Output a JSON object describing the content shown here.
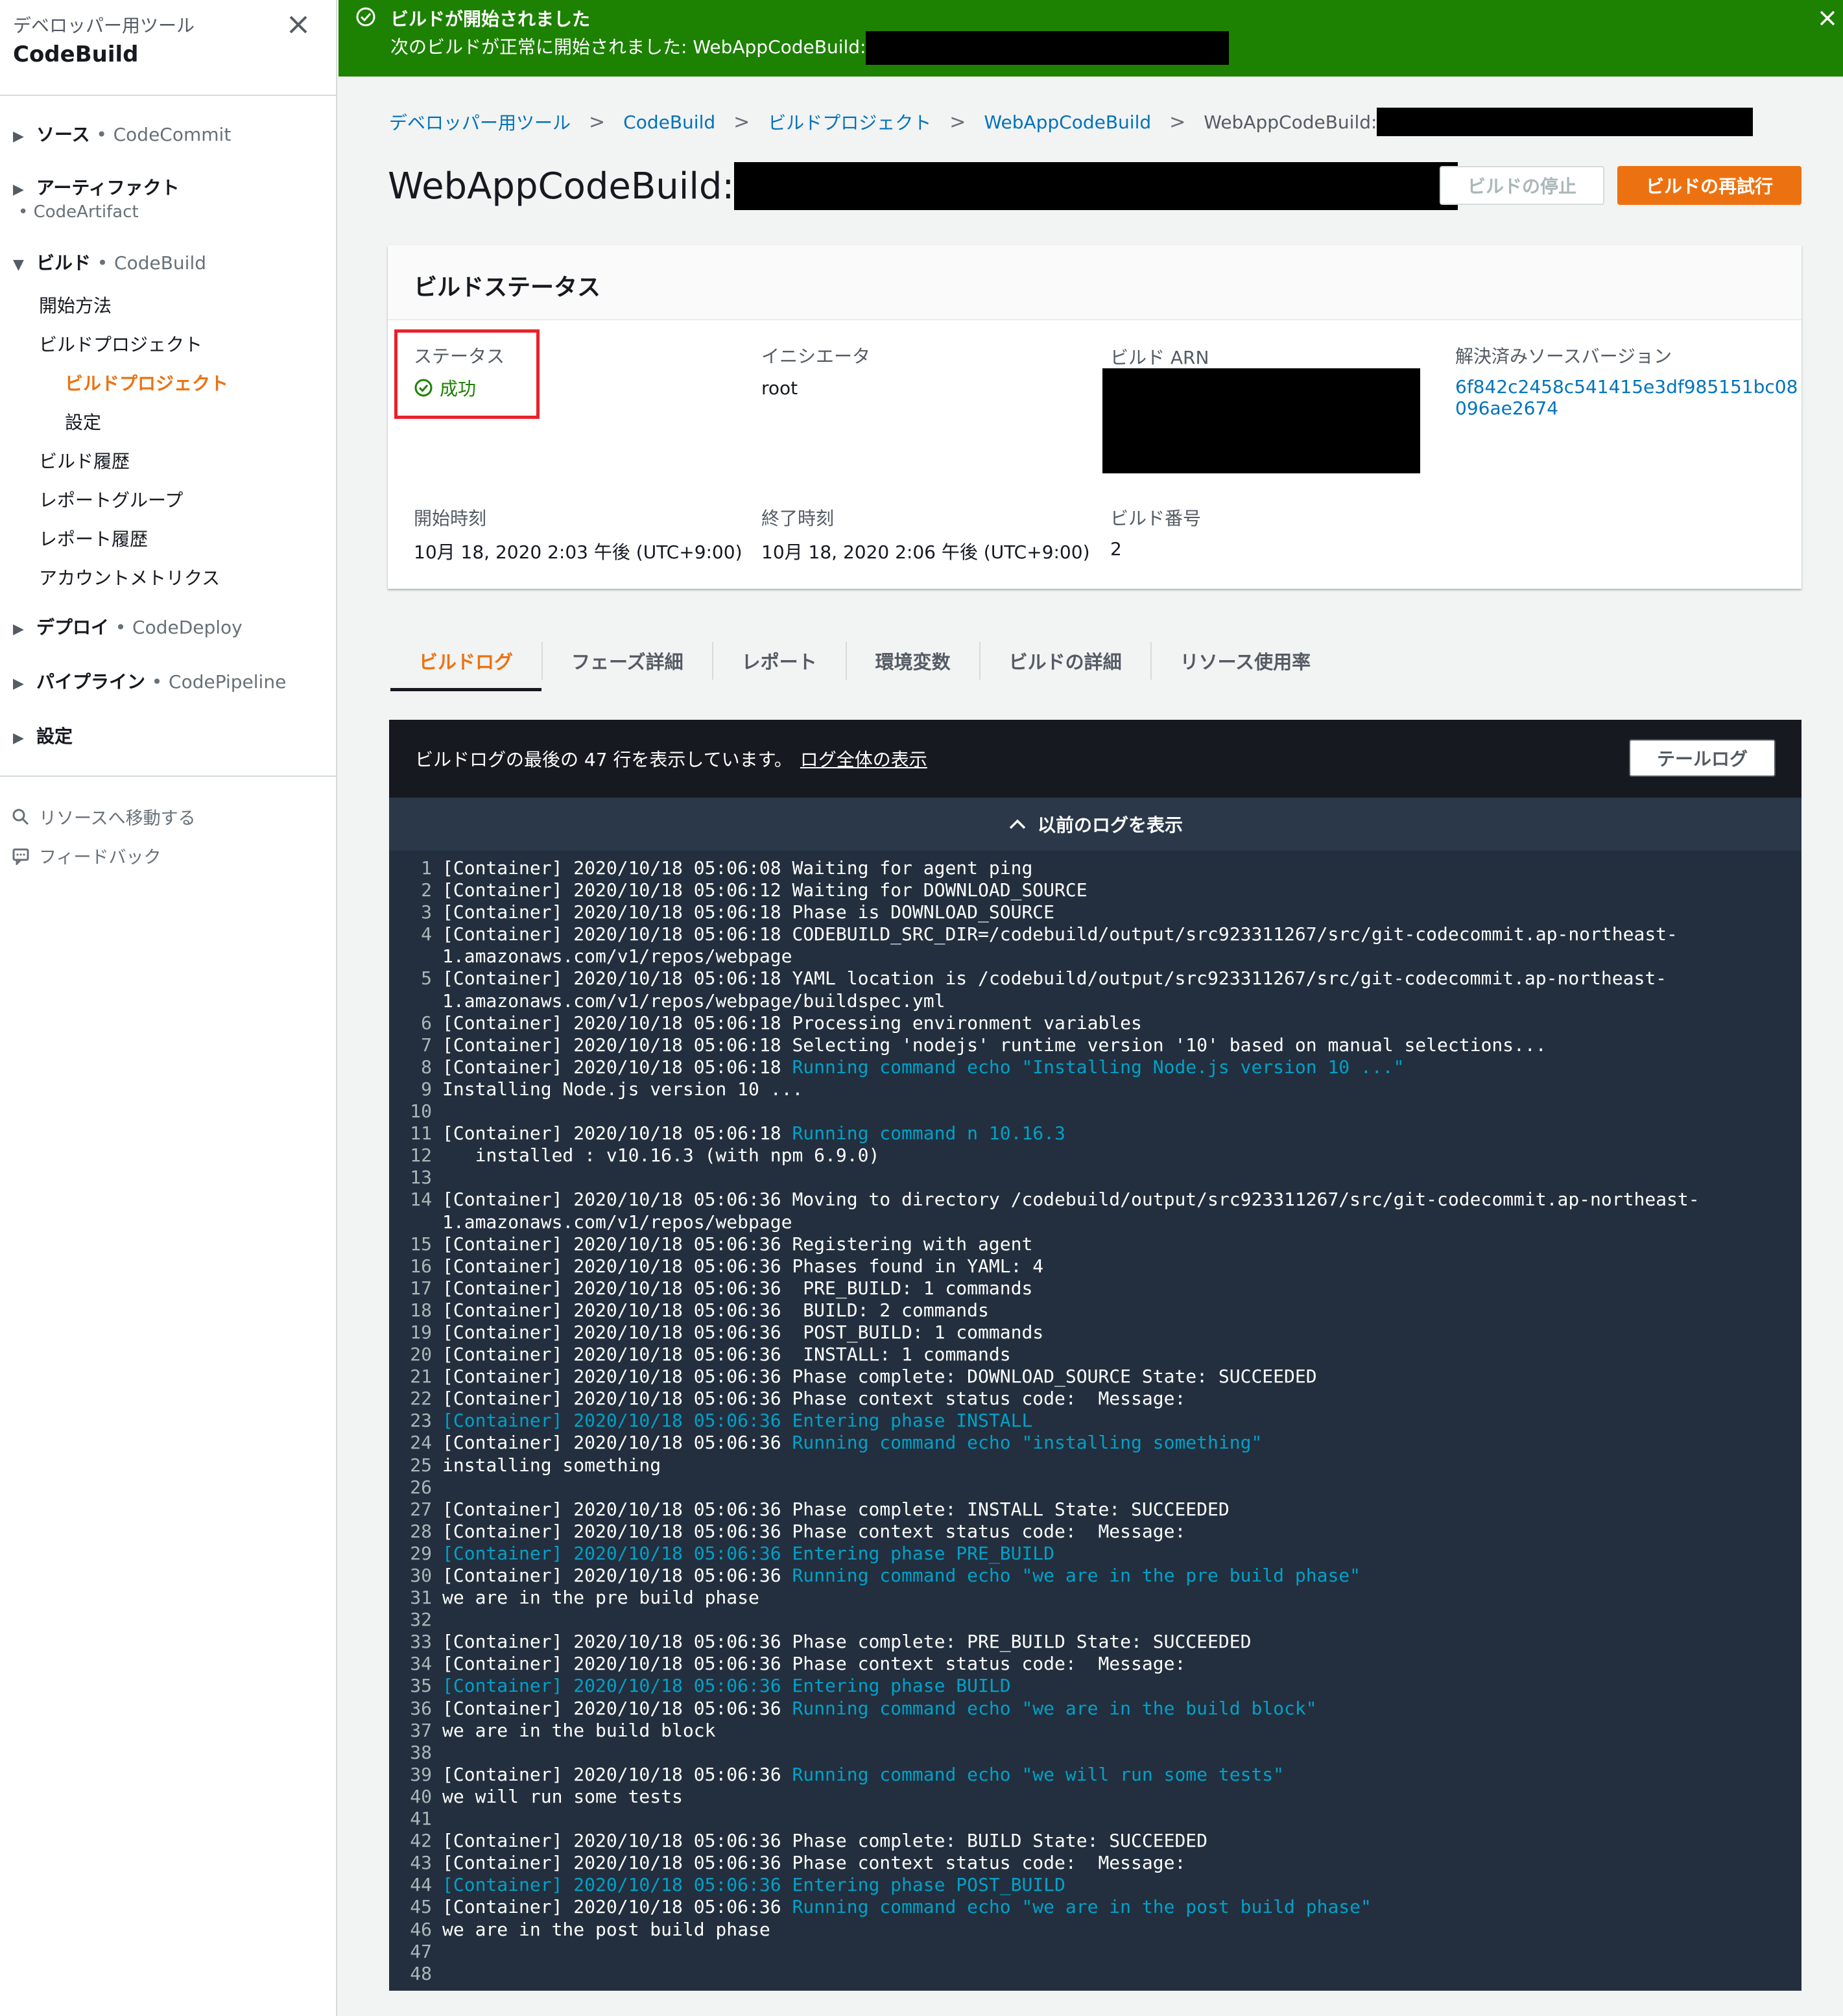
{
  "sidebar": {
    "service": "デベロッパー用ツール",
    "title": "CodeBuild",
    "sections": [
      {
        "label": "ソース",
        "service": "CodeCommit"
      },
      {
        "label": "アーティファクト",
        "service": "CodeArtifact"
      },
      {
        "label": "ビルド",
        "service": "CodeBuild"
      },
      {
        "label": "デプロイ",
        "service": "CodeDeploy"
      },
      {
        "label": "パイプライン",
        "service": "CodePipeline"
      },
      {
        "label": "設定",
        "service": ""
      }
    ],
    "build_items": [
      "開始方法",
      "ビルドプロジェクト",
      "ビルドプロジェクト",
      "設定",
      "ビルド履歴",
      "レポートグループ",
      "レポート履歴",
      "アカウントメトリクス"
    ],
    "utility": [
      "リソースへ移動する",
      "フィードバック"
    ]
  },
  "flash": {
    "title": "ビルドが開始されました",
    "message": "次のビルドが正常に開始されました: WebAppCodeBuild:"
  },
  "breadcrumb": [
    "デベロッパー用ツール",
    "CodeBuild",
    "ビルドプロジェクト",
    "WebAppCodeBuild",
    "WebAppCodeBuild:"
  ],
  "page": {
    "title": "WebAppCodeBuild:",
    "stop_button": "ビルドの停止",
    "retry_button": "ビルドの再試行"
  },
  "status_card": {
    "title": "ビルドステータス",
    "status_label": "ステータス",
    "status_value": "成功",
    "initiator_label": "イニシエータ",
    "initiator_value": "root",
    "arn_label": "ビルド ARN",
    "source_version_label": "解決済みソースバージョン",
    "source_version_line1": "6f842c2458c541415e3df985151bc08",
    "source_version_line2": "096ae2674",
    "start_label": "開始時刻",
    "start_value": "10月 18, 2020 2:03 午後 (UTC+9:00)",
    "end_label": "終了時刻",
    "end_value": "10月 18, 2020 2:06 午後 (UTC+9:00)",
    "build_number_label": "ビルド番号",
    "build_number_value": "2"
  },
  "tabs": [
    "ビルドログ",
    "フェーズ詳細",
    "レポート",
    "環境変数",
    "ビルドの詳細",
    "リソース使用率"
  ],
  "log": {
    "info": "ビルドログの最後の 47 行を表示しています。",
    "full_link": "ログ全体の表示",
    "tail_button": "テールログ",
    "previous": "以前のログを表示",
    "lines": [
      {
        "n": "1",
        "segs": [
          [
            "[Container] 2020/10/18 05:06:08 Waiting for agent ping",
            ""
          ]
        ]
      },
      {
        "n": "2",
        "segs": [
          [
            "[Container] 2020/10/18 05:06:12 Waiting for DOWNLOAD_SOURCE",
            ""
          ]
        ]
      },
      {
        "n": "3",
        "segs": [
          [
            "[Container] 2020/10/18 05:06:18 Phase is DOWNLOAD_SOURCE",
            ""
          ]
        ]
      },
      {
        "n": "4",
        "segs": [
          [
            "[Container] 2020/10/18 05:06:18 CODEBUILD_SRC_DIR=/codebuild/output/src923311267/src/git-codecommit.ap-northeast-",
            ""
          ]
        ]
      },
      {
        "n": "",
        "segs": [
          [
            "1.amazonaws.com/v1/repos/webpage",
            ""
          ]
        ]
      },
      {
        "n": "5",
        "segs": [
          [
            "[Container] 2020/10/18 05:06:18 YAML location is /codebuild/output/src923311267/src/git-codecommit.ap-northeast-",
            ""
          ]
        ]
      },
      {
        "n": "",
        "segs": [
          [
            "1.amazonaws.com/v1/repos/webpage/buildspec.yml",
            ""
          ]
        ]
      },
      {
        "n": "6",
        "segs": [
          [
            "[Container] 2020/10/18 05:06:18 Processing environment variables",
            ""
          ]
        ]
      },
      {
        "n": "7",
        "segs": [
          [
            "[Container] 2020/10/18 05:06:18 Selecting 'nodejs' runtime version '10' based on manual selections...",
            ""
          ]
        ]
      },
      {
        "n": "8",
        "segs": [
          [
            "[Container] 2020/10/18 05:06:18 ",
            ""
          ],
          [
            "Running command echo \"Installing Node.js version 10 ...\"",
            "c"
          ]
        ]
      },
      {
        "n": "9",
        "segs": [
          [
            "Installing Node.js version 10 ...",
            ""
          ]
        ]
      },
      {
        "n": "10",
        "segs": [
          [
            "",
            ""
          ]
        ]
      },
      {
        "n": "11",
        "segs": [
          [
            "[Container] 2020/10/18 05:06:18 ",
            ""
          ],
          [
            "Running command n 10.16.3",
            "c"
          ]
        ]
      },
      {
        "n": "12",
        "segs": [
          [
            "   installed : v10.16.3 (with npm 6.9.0)",
            ""
          ]
        ]
      },
      {
        "n": "13",
        "segs": [
          [
            "",
            ""
          ]
        ]
      },
      {
        "n": "14",
        "segs": [
          [
            "[Container] 2020/10/18 05:06:36 Moving to directory /codebuild/output/src923311267/src/git-codecommit.ap-northeast-",
            ""
          ]
        ]
      },
      {
        "n": "",
        "segs": [
          [
            "1.amazonaws.com/v1/repos/webpage",
            ""
          ]
        ]
      },
      {
        "n": "15",
        "segs": [
          [
            "[Container] 2020/10/18 05:06:36 Registering with agent",
            ""
          ]
        ]
      },
      {
        "n": "16",
        "segs": [
          [
            "[Container] 2020/10/18 05:06:36 Phases found in YAML: 4",
            ""
          ]
        ]
      },
      {
        "n": "17",
        "segs": [
          [
            "[Container] 2020/10/18 05:06:36  PRE_BUILD: 1 commands",
            ""
          ]
        ]
      },
      {
        "n": "18",
        "segs": [
          [
            "[Container] 2020/10/18 05:06:36  BUILD: 2 commands",
            ""
          ]
        ]
      },
      {
        "n": "19",
        "segs": [
          [
            "[Container] 2020/10/18 05:06:36  POST_BUILD: 1 commands",
            ""
          ]
        ]
      },
      {
        "n": "20",
        "segs": [
          [
            "[Container] 2020/10/18 05:06:36  INSTALL: 1 commands",
            ""
          ]
        ]
      },
      {
        "n": "21",
        "segs": [
          [
            "[Container] 2020/10/18 05:06:36 Phase complete: DOWNLOAD_SOURCE State: SUCCEEDED",
            ""
          ]
        ]
      },
      {
        "n": "22",
        "segs": [
          [
            "[Container] 2020/10/18 05:06:36 Phase context status code:  Message:",
            ""
          ]
        ]
      },
      {
        "n": "23",
        "segs": [
          [
            "[Container] 2020/10/18 05:06:36 Entering phase INSTALL",
            "c"
          ]
        ]
      },
      {
        "n": "24",
        "segs": [
          [
            "[Container] 2020/10/18 05:06:36 ",
            ""
          ],
          [
            "Running command echo \"installing something\"",
            "c"
          ]
        ]
      },
      {
        "n": "25",
        "segs": [
          [
            "installing something",
            ""
          ]
        ]
      },
      {
        "n": "26",
        "segs": [
          [
            "",
            ""
          ]
        ]
      },
      {
        "n": "27",
        "segs": [
          [
            "[Container] 2020/10/18 05:06:36 Phase complete: INSTALL State: SUCCEEDED",
            ""
          ]
        ]
      },
      {
        "n": "28",
        "segs": [
          [
            "[Container] 2020/10/18 05:06:36 Phase context status code:  Message:",
            ""
          ]
        ]
      },
      {
        "n": "29",
        "segs": [
          [
            "[Container] 2020/10/18 05:06:36 Entering phase PRE_BUILD",
            "c"
          ]
        ]
      },
      {
        "n": "30",
        "segs": [
          [
            "[Container] 2020/10/18 05:06:36 ",
            ""
          ],
          [
            "Running command echo \"we are in the pre build phase\"",
            "c"
          ]
        ]
      },
      {
        "n": "31",
        "segs": [
          [
            "we are in the pre build phase",
            ""
          ]
        ]
      },
      {
        "n": "32",
        "segs": [
          [
            "",
            ""
          ]
        ]
      },
      {
        "n": "33",
        "segs": [
          [
            "[Container] 2020/10/18 05:06:36 Phase complete: PRE_BUILD State: SUCCEEDED",
            ""
          ]
        ]
      },
      {
        "n": "34",
        "segs": [
          [
            "[Container] 2020/10/18 05:06:36 Phase context status code:  Message:",
            ""
          ]
        ]
      },
      {
        "n": "35",
        "segs": [
          [
            "[Container] 2020/10/18 05:06:36 Entering phase BUILD",
            "c"
          ]
        ]
      },
      {
        "n": "36",
        "segs": [
          [
            "[Container] 2020/10/18 05:06:36 ",
            ""
          ],
          [
            "Running command echo \"we are in the build block\"",
            "c"
          ]
        ]
      },
      {
        "n": "37",
        "segs": [
          [
            "we are in the build block",
            ""
          ]
        ]
      },
      {
        "n": "38",
        "segs": [
          [
            "",
            ""
          ]
        ]
      },
      {
        "n": "39",
        "segs": [
          [
            "[Container] 2020/10/18 05:06:36 ",
            ""
          ],
          [
            "Running command echo \"we will run some tests\"",
            "c"
          ]
        ]
      },
      {
        "n": "40",
        "segs": [
          [
            "we will run some tests",
            ""
          ]
        ]
      },
      {
        "n": "41",
        "segs": [
          [
            "",
            ""
          ]
        ]
      },
      {
        "n": "42",
        "segs": [
          [
            "[Container] 2020/10/18 05:06:36 Phase complete: BUILD State: SUCCEEDED",
            ""
          ]
        ]
      },
      {
        "n": "43",
        "segs": [
          [
            "[Container] 2020/10/18 05:06:36 Phase context status code:  Message:",
            ""
          ]
        ]
      },
      {
        "n": "44",
        "segs": [
          [
            "[Container] 2020/10/18 05:06:36 Entering phase POST_BUILD",
            "c"
          ]
        ]
      },
      {
        "n": "45",
        "segs": [
          [
            "[Container] 2020/10/18 05:06:36 ",
            ""
          ],
          [
            "Running command echo \"we are in the post build phase\"",
            "c"
          ]
        ]
      },
      {
        "n": "46",
        "segs": [
          [
            "we are in the post build phase",
            ""
          ]
        ]
      },
      {
        "n": "47",
        "segs": [
          [
            "",
            ""
          ]
        ]
      },
      {
        "n": "48",
        "segs": [
          [
            "",
            ""
          ]
        ]
      }
    ]
  },
  "colors": {
    "accent": "#ec7211",
    "link": "#0073bb",
    "success": "#1d8102",
    "log_highlight": "#00a1c9",
    "log_background": "#232f3e"
  }
}
